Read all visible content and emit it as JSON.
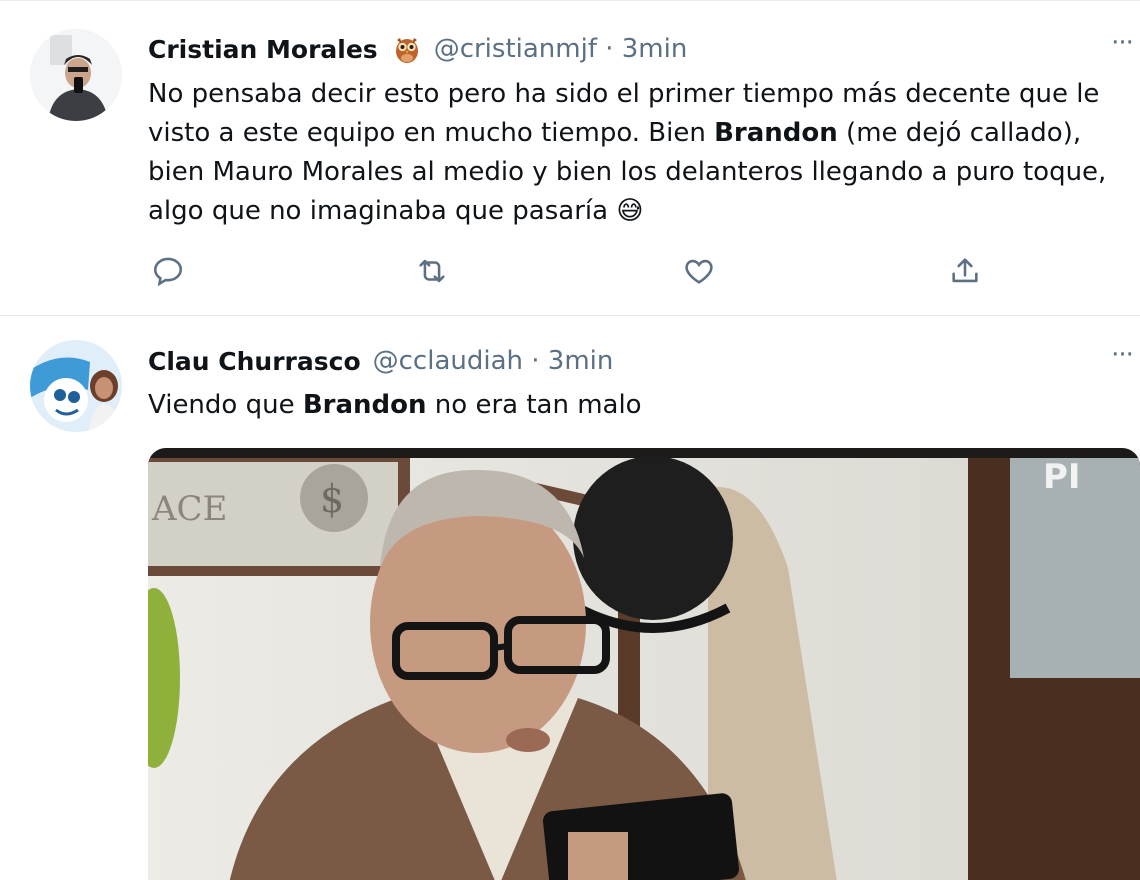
{
  "tweets": [
    {
      "name": "Cristian Morales",
      "badge_icon": "owl-emoji",
      "handle": "@cristianmjf · 3min",
      "more_label": "···",
      "text_parts": [
        "No pensaba decir esto pero ha sido el primer tiempo más decente que le visto a este equipo en mucho tiempo. Bien ",
        "Brandon",
        " (me dejó callado), bien Mauro Morales al medio y bien los delanteros llegando a puro toque, algo que no imaginaba que pasaría "
      ],
      "emoji": "😅",
      "actions": [
        "reply-icon",
        "retweet-icon",
        "like-icon",
        "share-icon"
      ]
    },
    {
      "name": "Clau Churrasco",
      "handle": "@cclaudiah · 3min",
      "more_label": "···",
      "text_parts": [
        "Viendo que ",
        "Brandon",
        " no era tan malo"
      ],
      "media": "embedded-gif"
    }
  ],
  "colors": {
    "text": "#0f1419",
    "secondary": "#5b7083",
    "divider": "#e6ecf0"
  }
}
